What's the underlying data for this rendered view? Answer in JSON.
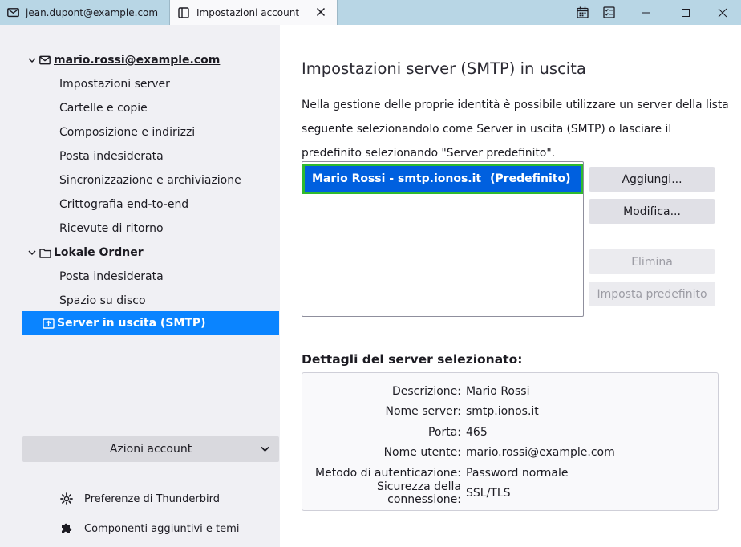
{
  "window": {
    "tabs": [
      {
        "label": "jean.dupont@example.com",
        "icon": "mail-icon"
      },
      {
        "label": "Impostazioni account",
        "icon": "settings-tab-icon",
        "active": true
      }
    ],
    "toolbar_icons": [
      "calendar-icon",
      "tasks-icon",
      "minimize-icon",
      "maximize-icon",
      "close-window-icon"
    ]
  },
  "sidebar": {
    "account": {
      "label": "mario.rossi@example.com",
      "children": [
        "Impostazioni server",
        "Cartelle e copie",
        "Composizione e indirizzi",
        "Posta indesiderata",
        "Sincronizzazione e archiviazione",
        "Crittografia end-to-end",
        "Ricevute di ritorno"
      ]
    },
    "local": {
      "label": "Lokale Ordner",
      "children": [
        "Posta indesiderata",
        "Spazio su disco"
      ]
    },
    "outgoing": {
      "label": "Server in uscita (SMTP)"
    },
    "account_actions": {
      "label": "Azioni account"
    },
    "links": [
      {
        "label": "Preferenze di Thunderbird",
        "icon": "gear-icon"
      },
      {
        "label": "Componenti aggiuntivi e temi",
        "icon": "puzzle-icon"
      }
    ]
  },
  "main": {
    "title": "Impostazioni server (SMTP) in uscita",
    "description": "Nella gestione delle proprie identità è possibile utilizzare un server della lista seguente selezionandolo come Server in uscita (SMTP) o lasciare il predefinito selezionando \"Server predefinito\".",
    "servers": [
      {
        "name": "Mario Rossi - smtp.ionos.it",
        "default_tag": "(Predefinito)",
        "selected": true
      }
    ],
    "buttons": {
      "add": "Aggiungi...",
      "edit": "Modifica...",
      "delete": "Elimina",
      "set_default": "Imposta predefinito"
    },
    "details_title": "Dettagli del server selezionato:",
    "details": [
      {
        "label": "Descrizione:",
        "value": "Mario Rossi"
      },
      {
        "label": "Nome server:",
        "value": "smtp.ionos.it"
      },
      {
        "label": "Porta:",
        "value": "465"
      },
      {
        "label": "Nome utente:",
        "value": "mario.rossi@example.com"
      },
      {
        "label": "Metodo di autenticazione:",
        "value": "Password normale"
      },
      {
        "label": "Sicurezza della connessione:",
        "value": "SSL/TLS"
      }
    ]
  },
  "colors": {
    "selected_row": "#0a84ff",
    "selected_server": "#0060df",
    "highlight_border": "#2fba2f",
    "titlebar": "#b8d6e5",
    "sidebar": "#f0f0f4"
  }
}
